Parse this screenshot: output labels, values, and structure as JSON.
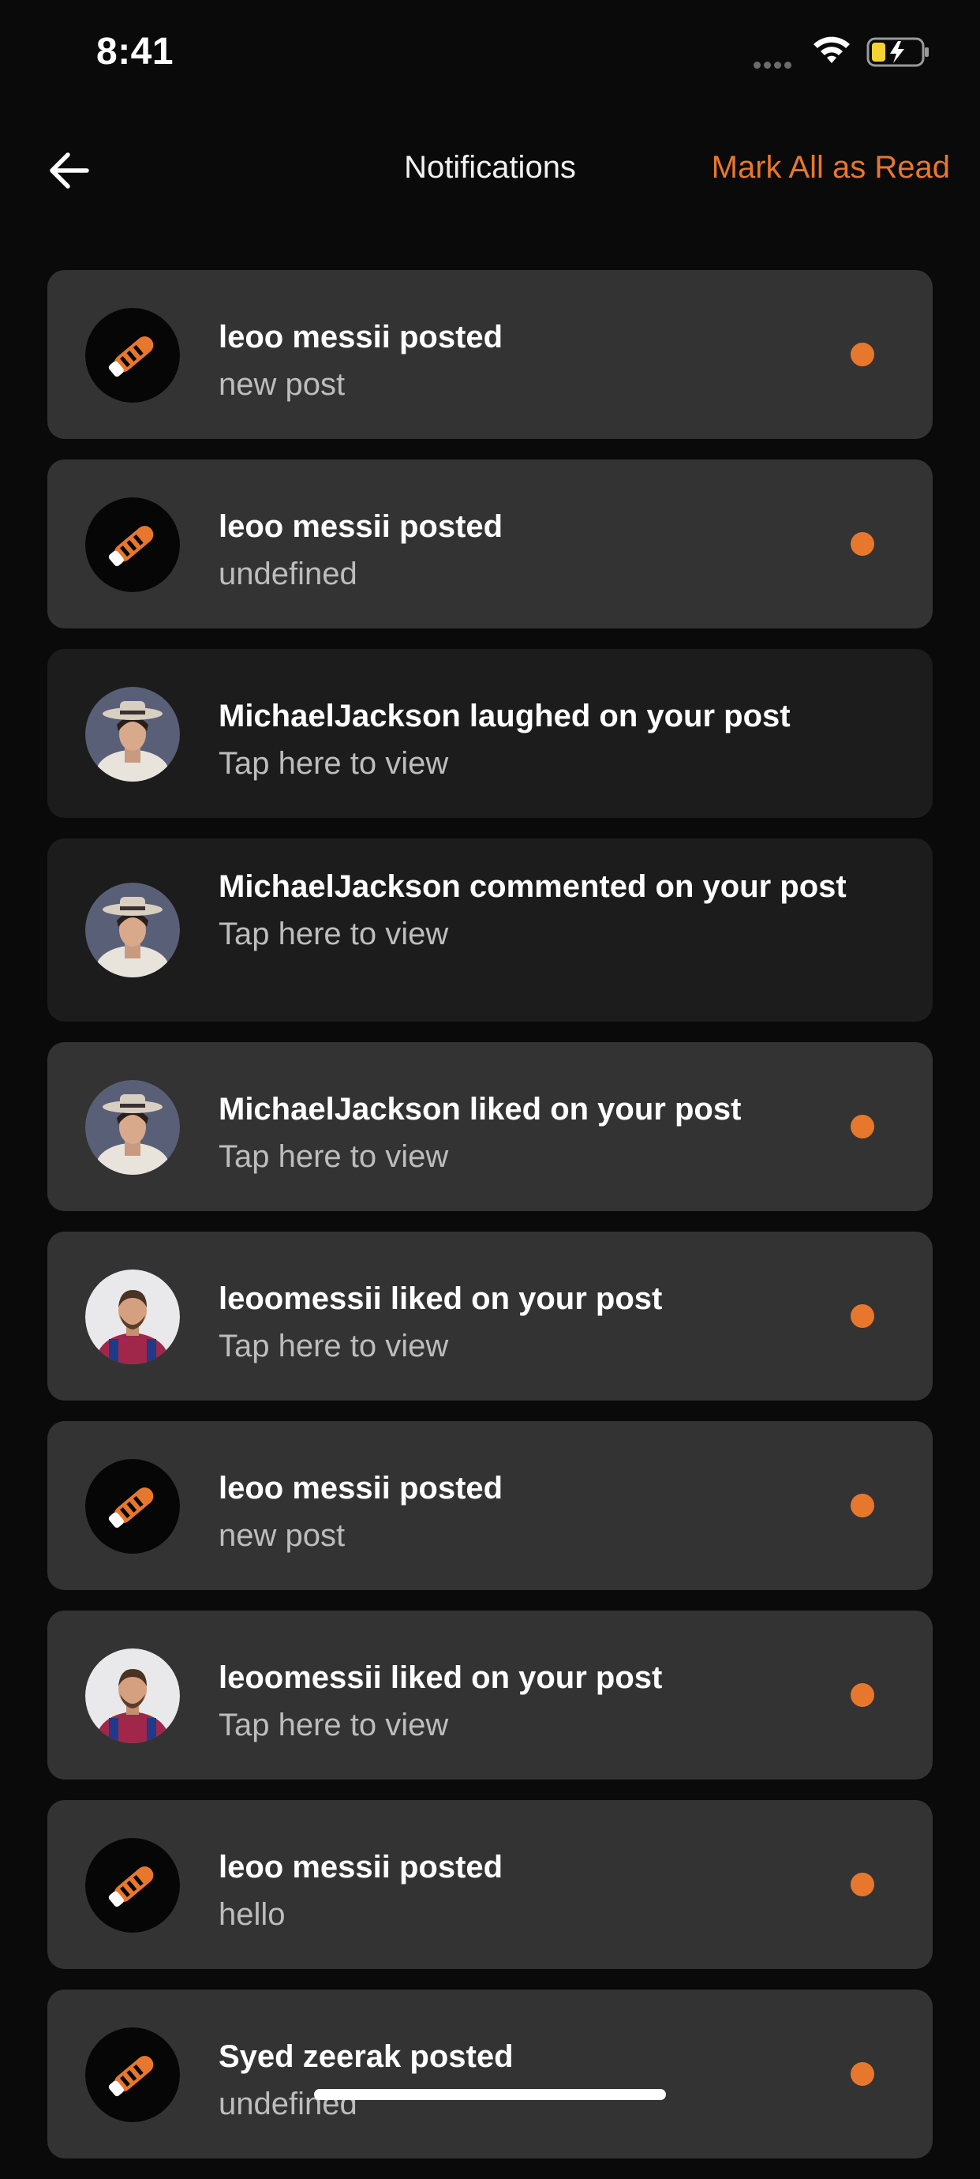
{
  "status_bar": {
    "time": "8:41"
  },
  "header": {
    "title": "Notifications",
    "mark_all_label": "Mark All as Read"
  },
  "colors": {
    "accent": "#e8772e",
    "background": "#0a0a0a",
    "card_unread": "#333333",
    "card_read": "#1c1c1c"
  },
  "notifications": [
    {
      "avatar": "shoe-logo-avatar",
      "title": "leoo messii posted",
      "subtitle": "new post",
      "unread": true
    },
    {
      "avatar": "shoe-logo-avatar",
      "title": "leoo messii posted",
      "subtitle": "undefined",
      "unread": true
    },
    {
      "avatar": "michael-jackson-avatar",
      "title": "MichaelJackson laughed on your post",
      "subtitle": "Tap here to view",
      "unread": false
    },
    {
      "avatar": "michael-jackson-avatar",
      "title": "MichaelJackson commented on your post",
      "subtitle": "Tap here to view",
      "unread": false
    },
    {
      "avatar": "michael-jackson-avatar",
      "title": "MichaelJackson liked on your post",
      "subtitle": "Tap here to view",
      "unread": true
    },
    {
      "avatar": "messi-avatar",
      "title": "leoomessii liked on your post",
      "subtitle": "Tap here to view",
      "unread": true
    },
    {
      "avatar": "shoe-logo-avatar",
      "title": "leoo messii posted",
      "subtitle": "new post",
      "unread": true
    },
    {
      "avatar": "messi-avatar",
      "title": "leoomessii liked on your post",
      "subtitle": "Tap here to view",
      "unread": true
    },
    {
      "avatar": "shoe-logo-avatar",
      "title": "leoo messii posted",
      "subtitle": "hello",
      "unread": true
    },
    {
      "avatar": "shoe-logo-avatar",
      "title": "Syed zeerak posted",
      "subtitle": "undefined",
      "unread": true
    }
  ]
}
